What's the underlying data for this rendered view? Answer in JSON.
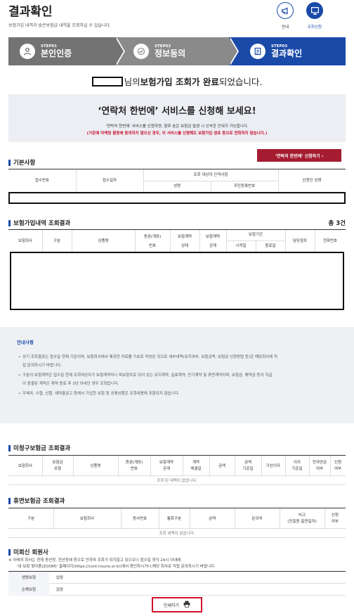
{
  "header": {
    "title": "결과확인",
    "subtitle": "보험가입 내역과 숨은보험금 내역을 조회하실 수 있습니다.",
    "buttons": [
      {
        "label": "안내",
        "icon": "megaphone-icon"
      },
      {
        "label": "조회신청",
        "icon": "monitor-icon"
      }
    ]
  },
  "steps": [
    {
      "num": "STEP01",
      "name": "본인인증",
      "icon": "person-icon"
    },
    {
      "num": "STEP02",
      "name": "정보동의",
      "icon": "check-icon"
    },
    {
      "num": "STEP03",
      "name": "결과확인",
      "icon": "document-icon"
    }
  ],
  "complete": {
    "pre": "님의 ",
    "bold1": "보험가입 조회가 완료",
    "post": "되었습니다."
  },
  "promo": {
    "heading": "‘연락처 한번에’ 서비스를 신청해 보세요!",
    "desc": "‘연락처 한번에’ 서비스를 신청하면, 향후 숨은 보험금 발생 시 신속한 안내가 가능합니다.",
    "warning": "(기존에 마케팅 활용에 동의하지 않으신 경우, 이 서비스를 신청해도 보험가입 권유 등으로 전화하지 않습니다.)",
    "button_label": "‘연락처 한번에’ 신청하기  ›"
  },
  "basic": {
    "title": "기본사항",
    "headers": {
      "receipt_no": "접수번호",
      "receipt_date": "접수일자",
      "target": "조회 대상자 인적사항",
      "name": "성명",
      "rrn": "주민등록번호",
      "applicant": "신청인 성명"
    }
  },
  "insurance": {
    "title": "보험가입내역 조회결과",
    "count": "총 3건",
    "headers": {
      "company": "보험회사",
      "type": "구분",
      "product": "상품명",
      "cert1": "증권(계좌)",
      "cert2": "번호",
      "status1": "보험계약",
      "status2": "상태",
      "rel1": "보험계약",
      "rel2": "관계",
      "period": "보험기간",
      "start": "시작일",
      "end": "종료일",
      "agent": "담당점포",
      "phone": "전화번호"
    }
  },
  "notice": {
    "title": "안내사항",
    "lines": [
      "상기 조회결과는 접수일 현재 기준이며, 보험회사에서 제공한 자료를 기초로 작성된 것으로 세부내역(유지여부, 보험금액, 보험금 신청방법 등)은 해당회사에 직",
      "접 문의하시기 바랍니다.",
      "구분의 보험계약은 접수일 현재 조회대상자가 보험계약자나 피보험자로 되어 있는 유지계약, 실효계약, 만기계약 및 휴면계약이며, 보험금, 해약금 등의 지급",
      "이 종결된 계약은 계약 종료 후 3년 이내인 경우 조회됩니다.",
      "우체국, 수협, 신협, 새마을금고 등에서 가입한 보험 및 공제상품은 조회내용에 포함되지 않습니다."
    ]
  },
  "unclaimed": {
    "title": "미청구보험금 조회결과",
    "headers": [
      "보험회사",
      "보험금|유형",
      "상품명",
      "증권(계좌)|번호",
      "보험계약|관계",
      "계약|체결일",
      "금액",
      "금액|기준일",
      "가산이자",
      "이자|기준일",
      "잔여연금|여부",
      "신청|여부"
    ],
    "empty": "조회 된 내역이 없습니다."
  },
  "dormant": {
    "title": "휴면보험금 조회결과",
    "headers": [
      "구분",
      "보험회사",
      "증서번호",
      "통화구분",
      "금액",
      "문의처",
      "비고|(진흥원 출연일자)",
      "신청|여부"
    ],
    "empty": "조회 내역이 없습니다."
  },
  "nonreply": {
    "title": "미회신 회원사",
    "note1": "※ 아래의 회사는 현재 동산망, 전산장애 등으로 인하여 조회가 되지않고 있으오니 접수일 정각 24시 이내에",
    "note2": "'내 보험 찾아줌(ZOOM)' 홈페이지(https://cont.insure.or.kr)에서 확인하시거나,해당 회사로 직접 문의하시기 바랍니다.",
    "rows": [
      {
        "label": "생명보험",
        "value": "없음"
      },
      {
        "label": "손해보험",
        "value": "없음"
      }
    ]
  },
  "print_label": "인쇄하기"
}
